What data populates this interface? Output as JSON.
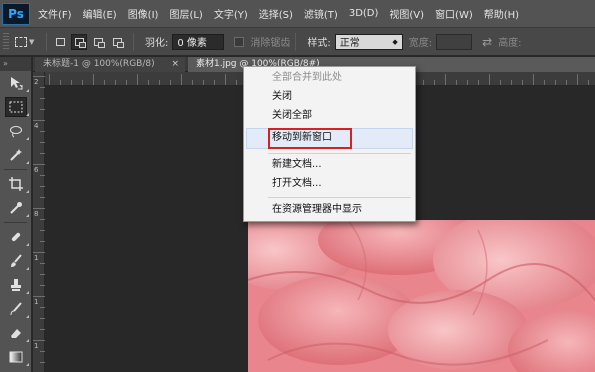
{
  "app": {
    "logo": "Ps"
  },
  "menubar": {
    "items": [
      "文件(F)",
      "编辑(E)",
      "图像(I)",
      "图层(L)",
      "文字(Y)",
      "选择(S)",
      "滤镜(T)",
      "3D(D)",
      "视图(V)",
      "窗口(W)",
      "帮助(H)"
    ]
  },
  "options": {
    "feather_label": "羽化:",
    "feather_value": "0 像素",
    "antialias_label": "消除锯齿",
    "style_label": "样式:",
    "style_value": "正常",
    "width_label": "宽度:",
    "height_label": "高度:"
  },
  "tabs": [
    {
      "label": "未标题-1 @ 100%(RGB/8)",
      "close": "×",
      "active": false
    },
    {
      "label": "素材1.jpg @ 100%(RGB/8#)",
      "close": "×",
      "active": true
    }
  ],
  "rulers": {
    "vertical": [
      "2",
      "4",
      "6",
      "8",
      "1",
      "1",
      "1"
    ]
  },
  "context_menu": {
    "items": [
      {
        "label": "全部合并到此处",
        "disabled": true
      },
      {
        "label": "关闭",
        "disabled": false
      },
      {
        "label": "关闭全部",
        "disabled": false
      },
      {
        "label": "移动到新窗口",
        "disabled": false,
        "highlighted": true
      },
      {
        "label": "新建文档...",
        "disabled": false
      },
      {
        "label": "打开文档...",
        "disabled": false
      },
      {
        "label": "在资源管理器中显示",
        "disabled": false
      }
    ]
  },
  "colors": {
    "menubar_bg": "#535353",
    "workspace_bg": "#282828",
    "highlight_border": "#d42121",
    "rose": "#ec8d93"
  },
  "icons": [
    "move-icon",
    "marquee-icon",
    "lasso-icon",
    "quick-select-icon",
    "crop-icon",
    "eyedropper-icon",
    "healing-brush-icon",
    "brush-icon",
    "clone-stamp-icon",
    "history-brush-icon",
    "eraser-icon",
    "gradient-icon"
  ]
}
